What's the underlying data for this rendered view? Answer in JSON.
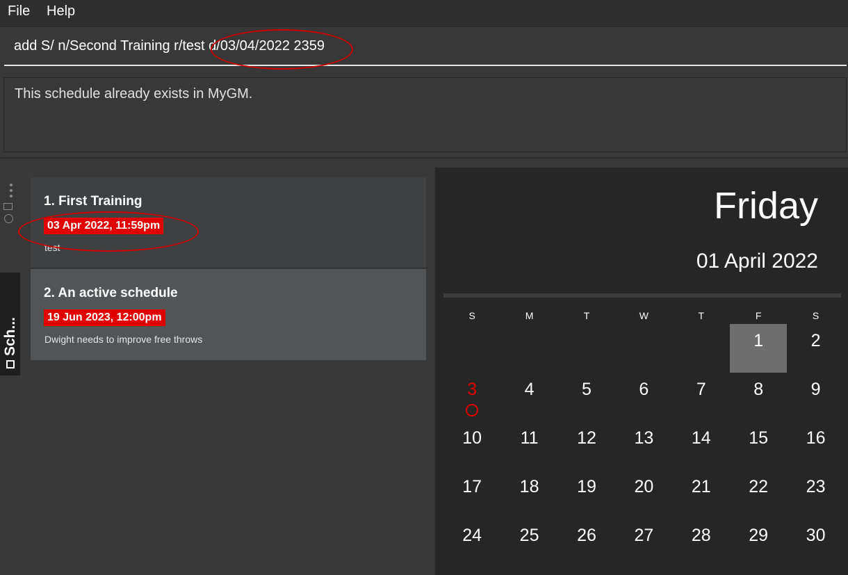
{
  "menu": {
    "file": "File",
    "help": "Help"
  },
  "command": {
    "value": "add S/ n/Second Training r/test d/03/04/2022 2359",
    "placeholder": ""
  },
  "result": {
    "message": "This schedule already exists in MyGM."
  },
  "tab": {
    "label": "Sch..."
  },
  "schedules": [
    {
      "title": "1.  First Training",
      "date": "03 Apr 2022, 11:59pm",
      "description": "test"
    },
    {
      "title": "2.  An active schedule",
      "date": "19 Jun 2023, 12:00pm",
      "description": "Dwight needs to improve free throws"
    }
  ],
  "calendar": {
    "day_name": "Friday",
    "full_date": "01 April 2022",
    "weekdays": [
      "S",
      "M",
      "T",
      "W",
      "T",
      "F",
      "S"
    ],
    "days": [
      "1",
      "2",
      "3",
      "4",
      "5",
      "6",
      "7",
      "8",
      "9",
      "10",
      "11",
      "12",
      "13",
      "14",
      "15",
      "16",
      "17",
      "18",
      "19",
      "20",
      "21",
      "22",
      "23",
      "24",
      "25",
      "26",
      "27",
      "28",
      "29",
      "30"
    ],
    "first_weekday_index": 5,
    "selected_day": "1",
    "event_day": "3"
  },
  "colors": {
    "accent": "#e00000",
    "panel": "#262626",
    "background": "#383838"
  }
}
